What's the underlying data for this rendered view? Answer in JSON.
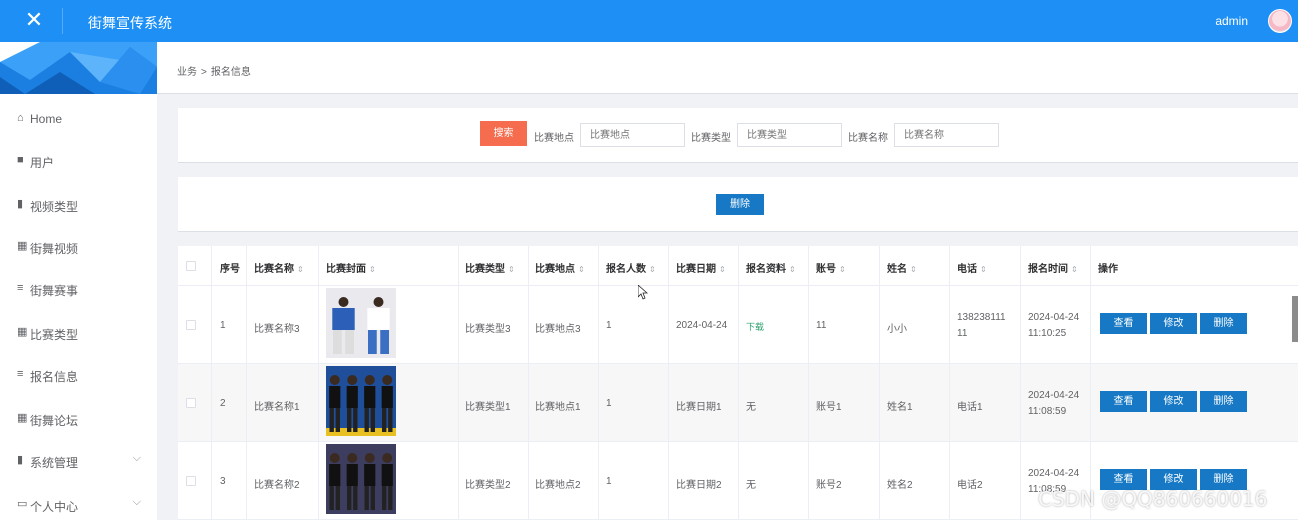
{
  "header": {
    "close_icon": "close-icon",
    "app_title": "街舞宣传系统",
    "user_name": "admin"
  },
  "sidebar": {
    "items": [
      {
        "icon": "home-icon",
        "glyph": "⌂",
        "label": "Home"
      },
      {
        "icon": "chat-icon",
        "glyph": "■",
        "label": "用户"
      },
      {
        "icon": "bar-chart-icon",
        "glyph": "▮",
        "label": "视频类型"
      },
      {
        "icon": "grid-icon",
        "glyph": "▦",
        "label": "街舞视频"
      },
      {
        "icon": "list-icon",
        "glyph": "≡",
        "label": "街舞赛事"
      },
      {
        "icon": "grid-icon",
        "glyph": "▦",
        "label": "比赛类型"
      },
      {
        "icon": "list-icon",
        "glyph": "≡",
        "label": "报名信息"
      },
      {
        "icon": "grid-icon",
        "glyph": "▦",
        "label": "街舞论坛"
      },
      {
        "icon": "bar-chart-icon",
        "glyph": "▮",
        "label": "系统管理",
        "expandable": true
      },
      {
        "icon": "box-icon",
        "glyph": "▭",
        "label": "个人中心",
        "expandable": true
      }
    ]
  },
  "breadcrumb": {
    "parent": "业务",
    "separator": ">",
    "current": "报名信息"
  },
  "search": {
    "button_label": "搜索",
    "fields": [
      {
        "label": "比赛地点",
        "placeholder": "比赛地点"
      },
      {
        "label": "比赛类型",
        "placeholder": "比赛类型"
      },
      {
        "label": "比赛名称",
        "placeholder": "比赛名称"
      }
    ]
  },
  "actions": {
    "batch_delete_label": "删除"
  },
  "table": {
    "columns": [
      "序号",
      "比赛名称",
      "比赛封面",
      "比赛类型",
      "比赛地点",
      "报名人数",
      "比赛日期",
      "报名资料",
      "账号",
      "姓名",
      "电话",
      "报名时间",
      "操作"
    ],
    "rows": [
      {
        "index": "1",
        "name": "比赛名称3",
        "type": "比赛类型3",
        "location": "比赛地点3",
        "count": "1",
        "date": "2024-04-24",
        "material": "下载",
        "material_is_link": true,
        "account": "11",
        "person": "小小",
        "phone_line1": "138238111",
        "phone_line2": "11",
        "time_line1": "2024-04-24",
        "time_line2": "11:10:25",
        "cover": "dancers-cover-1"
      },
      {
        "index": "2",
        "name": "比赛名称1",
        "type": "比赛类型1",
        "location": "比赛地点1",
        "count": "1",
        "date": "比赛日期1",
        "material": "无",
        "material_is_link": false,
        "account": "账号1",
        "person": "姓名1",
        "phone_line1": "电话1",
        "phone_line2": "",
        "time_line1": "2024-04-24",
        "time_line2": "11:08:59",
        "cover": "dancers-cover-2"
      },
      {
        "index": "3",
        "name": "比赛名称2",
        "type": "比赛类型2",
        "location": "比赛地点2",
        "count": "1",
        "date": "比赛日期2",
        "material": "无",
        "material_is_link": false,
        "account": "账号2",
        "person": "姓名2",
        "phone_line1": "电话2",
        "phone_line2": "",
        "time_line1": "2024-04-24",
        "time_line2": "11:08:59",
        "cover": "dancers-cover-3"
      }
    ],
    "ops": {
      "view": "查看",
      "edit": "修改",
      "delete": "删除"
    }
  },
  "watermark": "CSDN @QQ860660016",
  "colors": {
    "topbar": "#1e90f5",
    "search_button": "#f56c4f",
    "action_button": "#1779c5",
    "download_link": "#2a9d6b"
  }
}
